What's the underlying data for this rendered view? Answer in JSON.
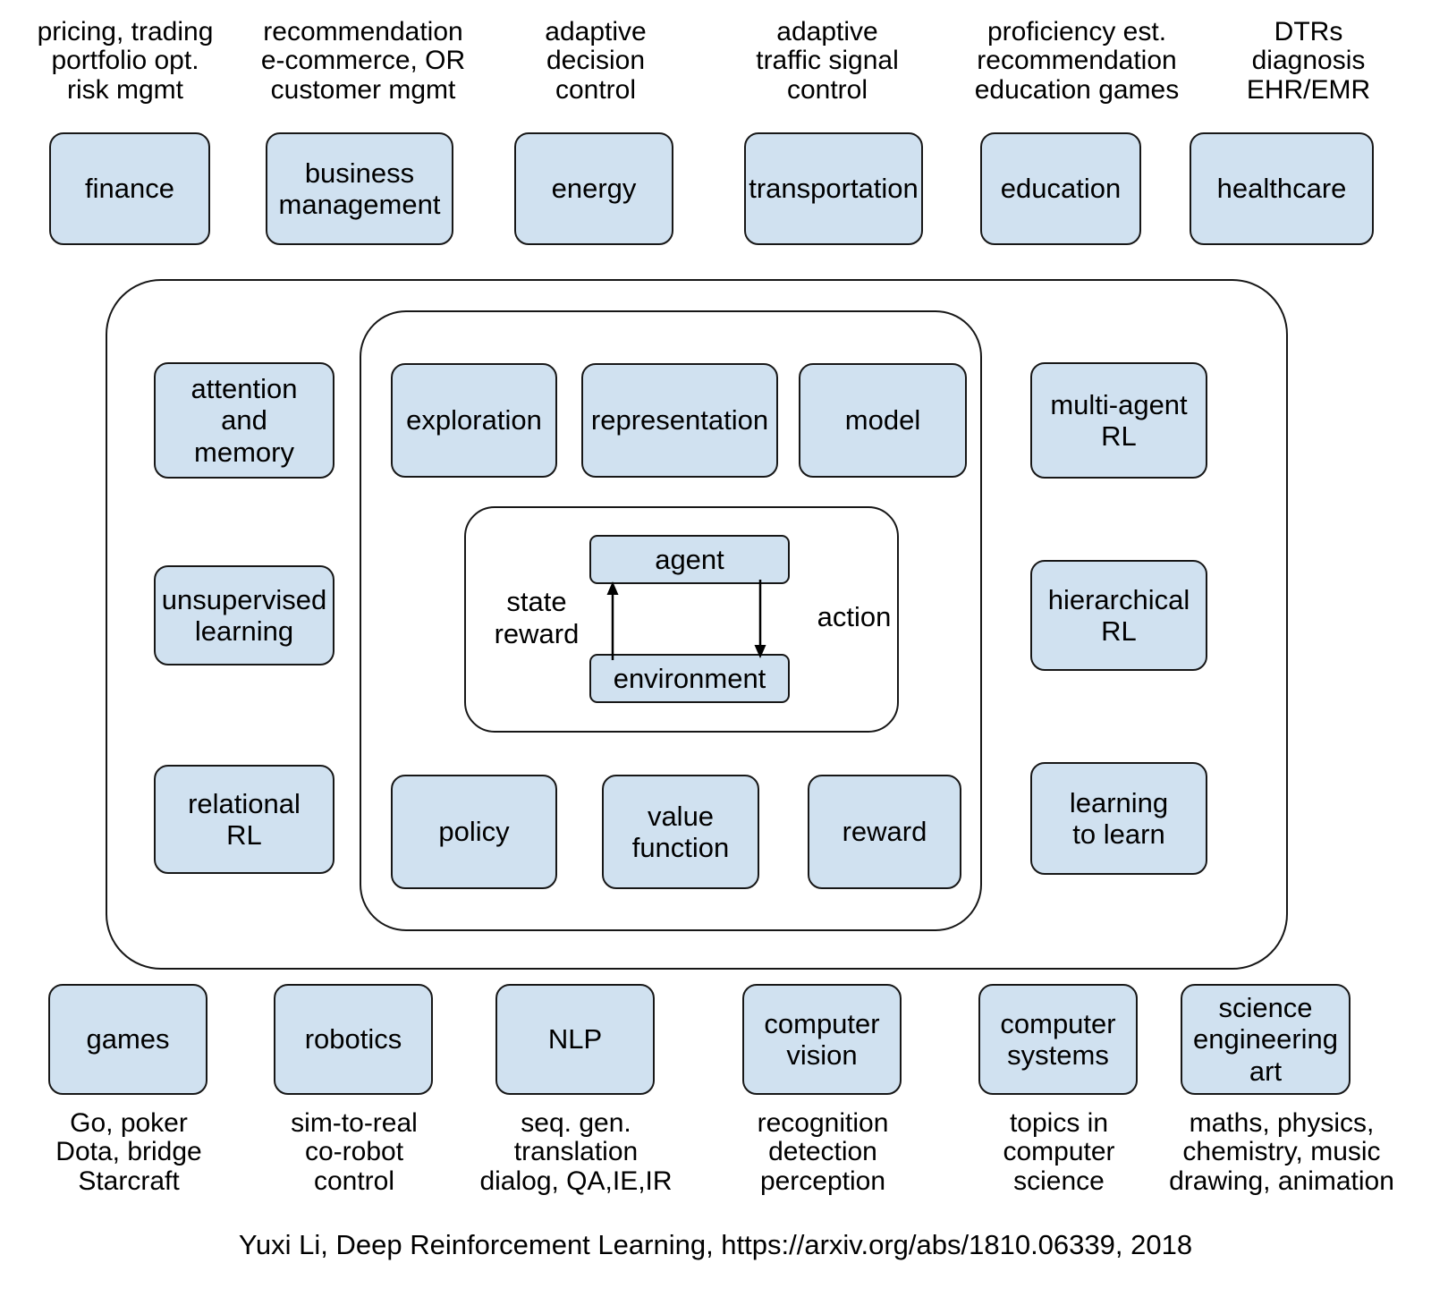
{
  "diagram": {
    "top_row": [
      {
        "caption": "pricing, trading\nportfolio opt.\nrisk mgmt",
        "label": "finance"
      },
      {
        "caption": "recommendation\ne-commerce, OR\ncustomer mgmt",
        "label": "business\nmanagement"
      },
      {
        "caption": "adaptive\ndecision\ncontrol",
        "label": "energy"
      },
      {
        "caption": "adaptive\ntraffic signal\ncontrol",
        "label": "transportation"
      },
      {
        "caption": "proficiency est.\nrecommendation\neducation games",
        "label": "education"
      },
      {
        "caption": "DTRs\ndiagnosis\nEHR/EMR",
        "label": "healthcare"
      }
    ],
    "left_column": [
      {
        "label": "attention\nand\nmemory"
      },
      {
        "label": "unsupervised\nlearning"
      },
      {
        "label": "relational\nRL"
      }
    ],
    "core_top": [
      {
        "label": "exploration"
      },
      {
        "label": "representation"
      },
      {
        "label": "model"
      }
    ],
    "core_bottom": [
      {
        "label": "policy"
      },
      {
        "label": "value\nfunction"
      },
      {
        "label": "reward"
      }
    ],
    "right_column": [
      {
        "label": "multi-agent\nRL"
      },
      {
        "label": "hierarchical\nRL"
      },
      {
        "label": "learning\nto learn"
      }
    ],
    "loop": {
      "agent_label": "agent",
      "environment_label": "environment",
      "left_label": "state\nreward",
      "right_label": "action"
    },
    "bottom_row": [
      {
        "label": "games",
        "caption": "Go, poker\nDota, bridge\nStarcraft"
      },
      {
        "label": "robotics",
        "caption": "sim-to-real\nco-robot\ncontrol"
      },
      {
        "label": "NLP",
        "caption": "seq. gen.\ntranslation\ndialog, QA,IE,IR"
      },
      {
        "label": "computer\nvision",
        "caption": "recognition\ndetection\nperception"
      },
      {
        "label": "computer\nsystems",
        "caption": "topics in\ncomputer\nscience"
      },
      {
        "label": "science\nengineering\nart",
        "caption": "maths, physics,\nchemistry, music\ndrawing, animation"
      }
    ],
    "footnote": "Yuxi Li, Deep Reinforcement Learning, https://arxiv.org/abs/1810.06339, 2018",
    "colors": {
      "box_fill": "#d0e1f0",
      "box_stroke": "#171717",
      "background": "#ffffff",
      "text": "#000000"
    }
  }
}
